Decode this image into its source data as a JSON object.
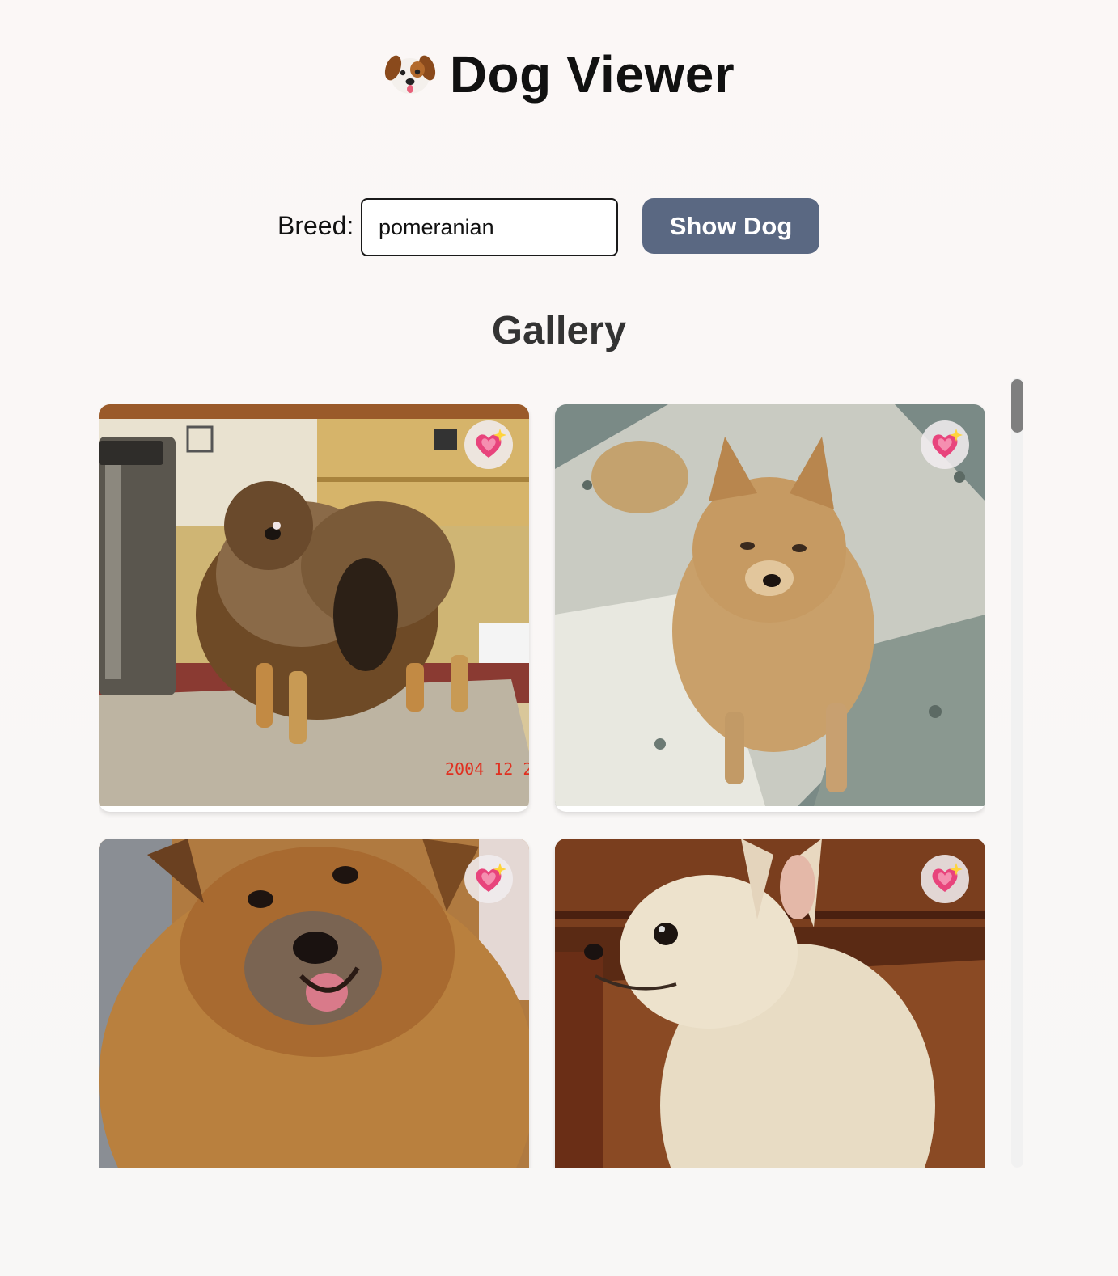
{
  "app": {
    "title": "Dog Viewer",
    "title_icon": "dog-face-icon"
  },
  "form": {
    "breed_label": "Breed:",
    "breed_value": "pomeranian",
    "submit_label": "Show Dog"
  },
  "gallery": {
    "heading": "Gallery",
    "favorite_icon": "sparkling-heart-icon",
    "images": [
      {
        "description": "pomeranian-on-rug",
        "date_stamp": "2004 12  2"
      },
      {
        "description": "pomeranian-on-gravel"
      },
      {
        "description": "pomeranian-closeup-tongue"
      },
      {
        "description": "cream-pomeranian-profile"
      }
    ]
  },
  "colors": {
    "button_bg": "#5a6882",
    "page_bg": "#f8f7f6",
    "heart": "#e8447c"
  }
}
